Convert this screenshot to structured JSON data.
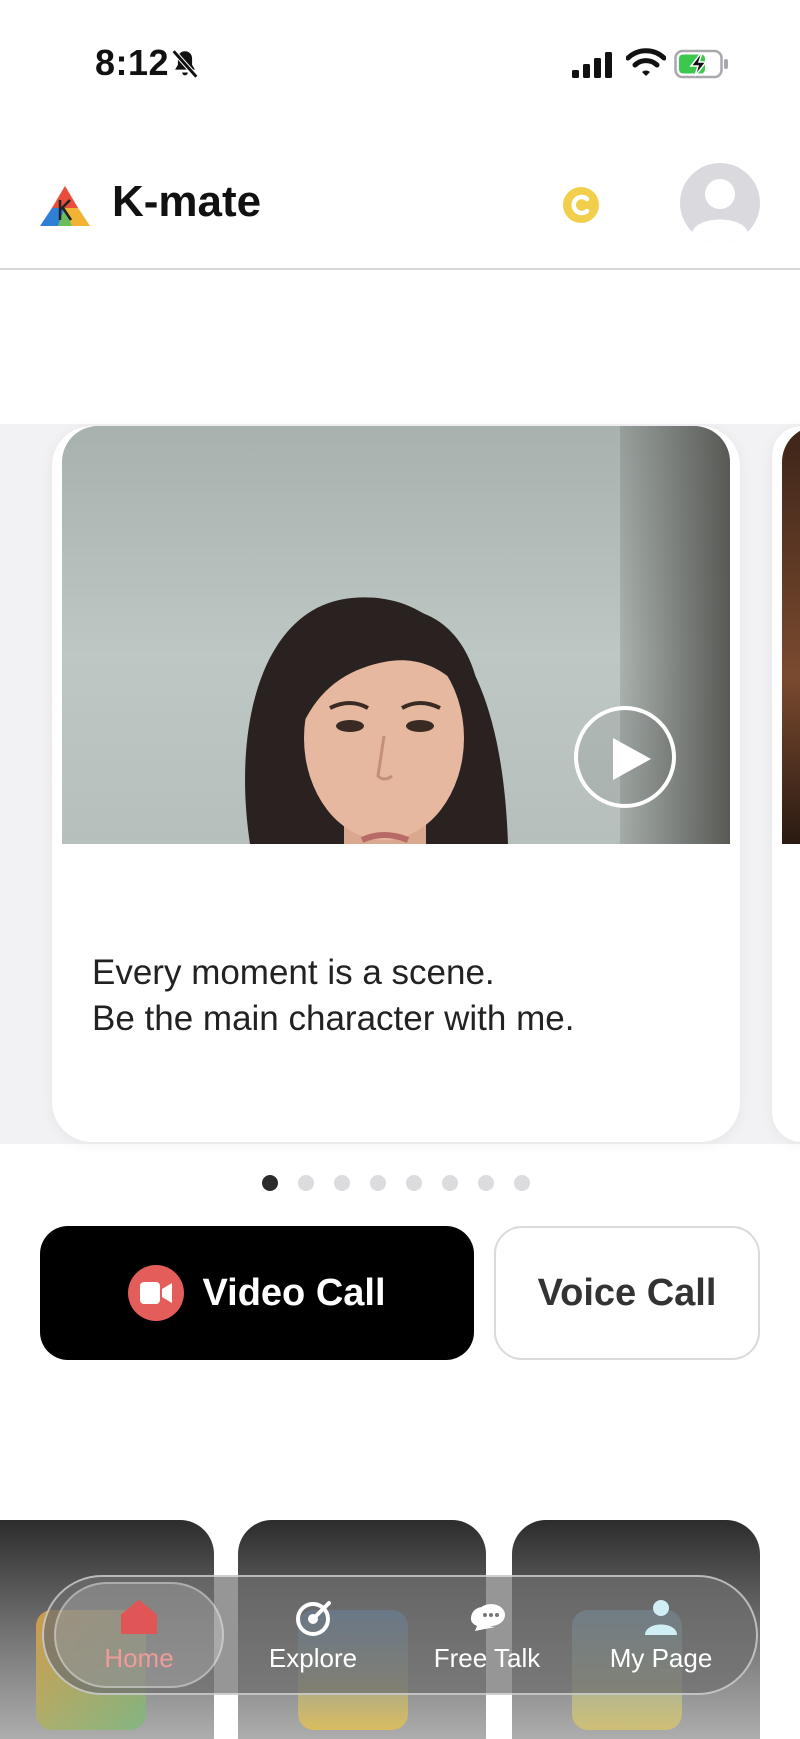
{
  "status_bar": {
    "time": "8:12",
    "bell_icon": "bell-slash-icon",
    "signal_icon": "cellular-signal-icon",
    "wifi_icon": "wifi-icon",
    "battery_icon": "battery-charging-icon"
  },
  "header": {
    "title": "K-mate",
    "logo_icon": "k-mate-logo-icon",
    "coin_icon": "coin-icon",
    "avatar_icon": "user-avatar-icon"
  },
  "carousel": {
    "cards": [
      {
        "caption_line1": "Every moment is a scene.",
        "caption_line2": "Be the main character with me.",
        "play_icon": "play-icon"
      }
    ],
    "page_count": 8,
    "active_page": 1
  },
  "actions": {
    "video_call_label": "Video Call",
    "video_call_icon": "video-camera-icon",
    "voice_call_label": "Voice Call"
  },
  "tab_bar": {
    "tabs": [
      {
        "label": "Home",
        "icon": "home-icon",
        "active": true
      },
      {
        "label": "Explore",
        "icon": "explore-icon",
        "active": false
      },
      {
        "label": "Free Talk",
        "icon": "chat-bubbles-icon",
        "active": false
      },
      {
        "label": "My Page",
        "icon": "person-icon",
        "active": false
      }
    ]
  },
  "colors": {
    "accent_red": "#e35d5b",
    "coin_yellow": "#f2cf4a",
    "primary_button": "#000000"
  }
}
